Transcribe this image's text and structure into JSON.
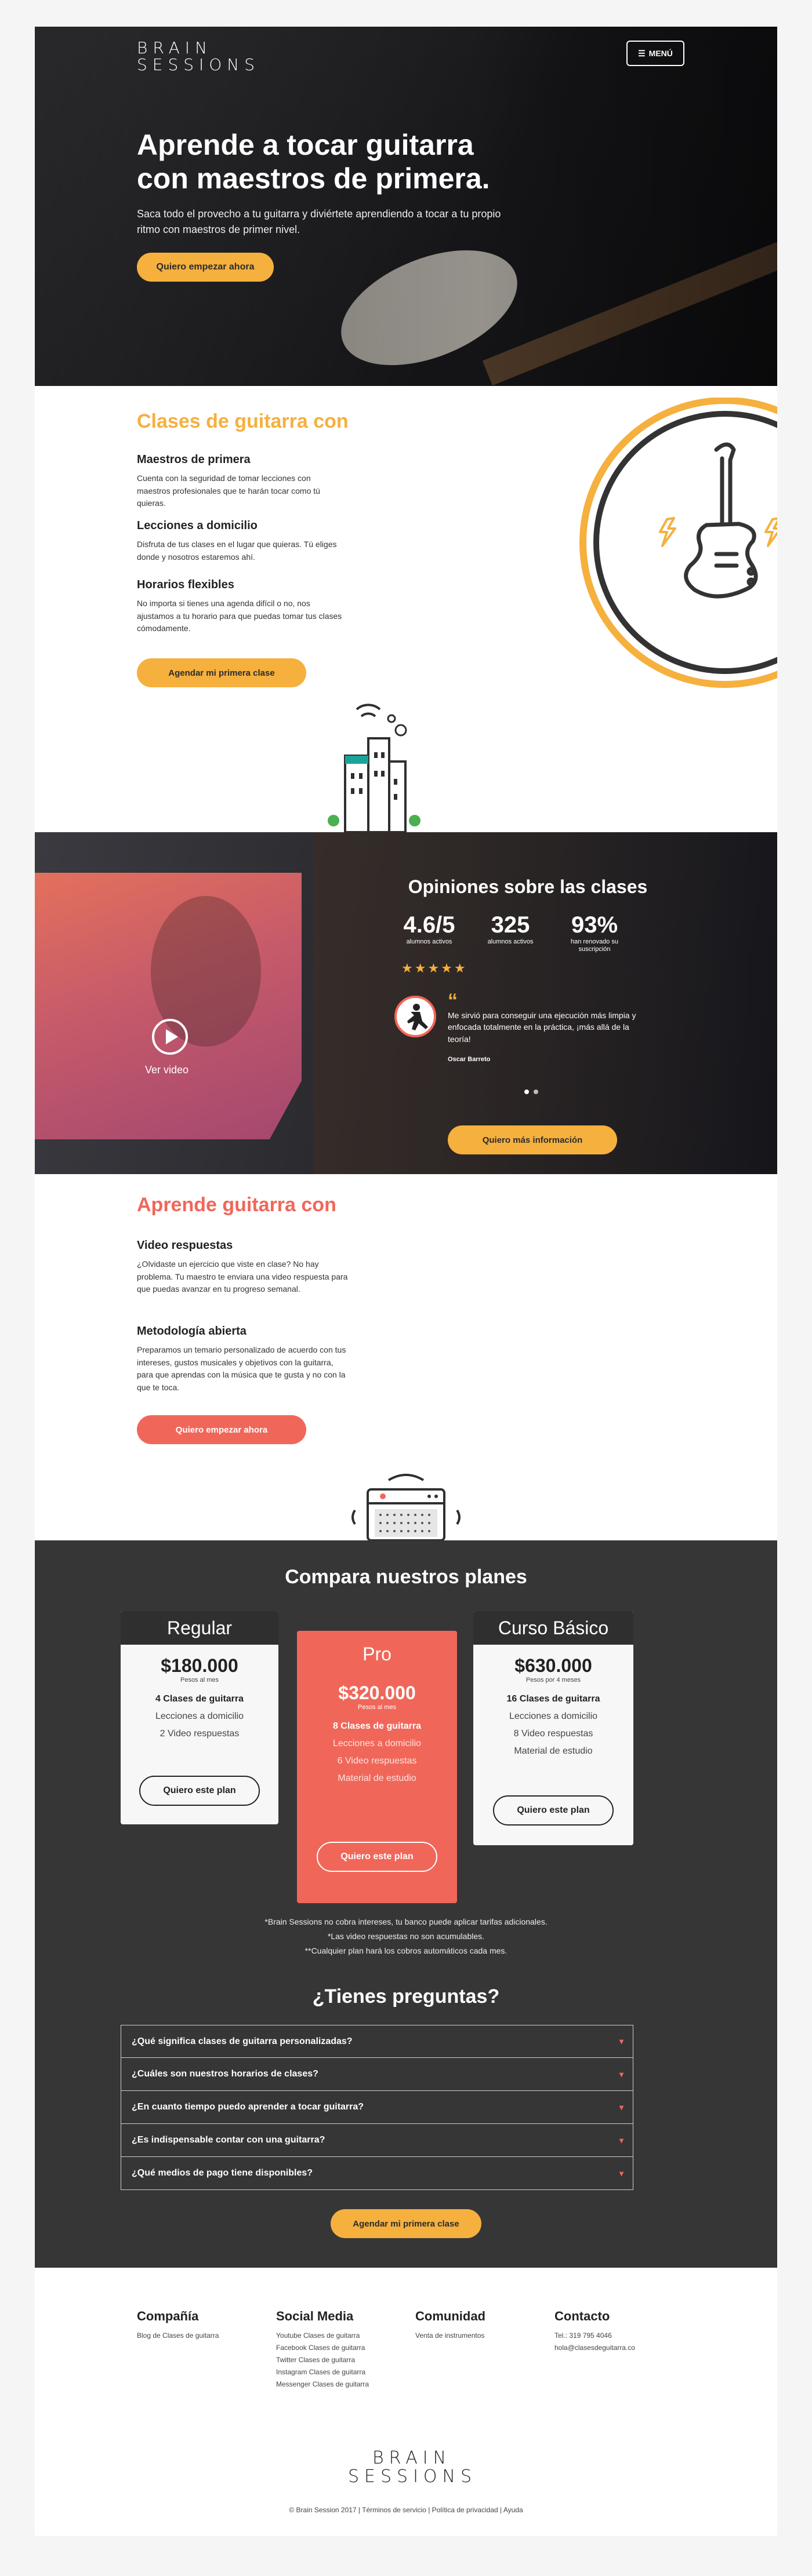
{
  "brand": {
    "logo_line1": "BRAIN",
    "logo_line2": "SESSIONS"
  },
  "nav": {
    "menu_label": "MENÚ",
    "menu_icon": "hamburger-icon"
  },
  "hero": {
    "title": "Aprende a tocar guitarra con maestros de primera.",
    "subtitle": "Saca todo el provecho a tu guitarra y diviértete aprendiendo a tocar a tu propio ritmo con maestros de primer nivel.",
    "cta": "Quiero empezar ahora"
  },
  "classes": {
    "heading": "Clases de guitarra con",
    "features": [
      {
        "title": "Maestros de primera",
        "text": "Cuenta con la seguridad de tomar lecciones con maestros profesionales que te harán tocar como tú quieras."
      },
      {
        "title": "Lecciones a domicilio",
        "text": "Disfruta de tus clases en el lugar que quieras. Tú eliges donde y nosotros estaremos ahí."
      },
      {
        "title": "Horarios flexibles",
        "text": "No importa si tienes una agenda difícil o no, nos ajustamos a tu horario para que puedas tomar tus clases cómodamente."
      }
    ],
    "cta": "Agendar mi primera clase",
    "illustration": "electric-guitar-icon"
  },
  "reviews": {
    "video_label": "Ver video",
    "heading": "Opiniones sobre las clases",
    "stats": [
      {
        "value": "4.6/5",
        "label": "alumnos activos"
      },
      {
        "value": "325",
        "label": "alumnos activos"
      },
      {
        "value": "93%",
        "label": "han renovado su suscripción"
      }
    ],
    "rating_stars": 5,
    "quote": "Me sirvió para conseguir una ejecución más limpia y enfocada totalmente en la práctica, ¡más allá de la teoría!",
    "author": "Oscar Barreto",
    "cta": "Quiero más información"
  },
  "learn": {
    "heading": "Aprende guitarra con",
    "features": [
      {
        "title": "Video respuestas",
        "text": "¿Olvidaste un ejercicio que viste en clase? No hay problema. Tu maestro te enviara una video respuesta para que puedas avanzar en tu progreso semanal."
      },
      {
        "title": "Metodología abierta",
        "text": "Preparamos un temario personalizado de acuerdo con tus intereses, gustos musicales y objetivos con la guitarra, para que aprendas con la música que te gusta y no con la que te toca."
      }
    ],
    "cta": "Quiero empezar ahora"
  },
  "plans": {
    "heading": "Compara nuestros planes",
    "items": [
      {
        "name": "Regular",
        "price": "$180.000",
        "period": "Pesos al mes",
        "features": [
          "4 Clases de guitarra",
          "Lecciones a domicilio",
          "2 Video respuestas"
        ],
        "cta": "Quiero este plan"
      },
      {
        "name": "Pro",
        "price": "$320.000",
        "period": "Pesos al mes",
        "features": [
          "8 Clases de guitarra",
          "Lecciones a domicilio",
          "6 Video respuestas",
          "Material de estudio"
        ],
        "cta": "Quiero este plan"
      },
      {
        "name": "Curso Básico",
        "price": "$630.000",
        "period": "Pesos por 4 meses",
        "features": [
          "16 Clases de guitarra",
          "Lecciones a domicilio",
          "8 Video respuestas",
          "Material de estudio"
        ],
        "cta": "Quiero este plan"
      }
    ],
    "notes": [
      "*Brain Sessions no cobra intereses, tu banco puede aplicar tarifas adicionales.",
      "*Las video respuestas no son acumulables.",
      "**Cualquier plan hará los cobros automáticos cada mes."
    ]
  },
  "faq": {
    "heading": "¿Tienes preguntas?",
    "items": [
      "¿Qué significa clases de guitarra personalizadas?",
      "¿Cuáles son nuestros horarios de clases?",
      "¿En cuanto tiempo puedo aprender a tocar guitarra?",
      "¿Es indispensable contar con una guitarra?",
      "¿Qué medios de pago tiene disponibles?"
    ],
    "cta": "Agendar mi primera clase"
  },
  "footer": {
    "columns": [
      {
        "title": "Compañía",
        "links": [
          "Blog de Clases de guitarra"
        ]
      },
      {
        "title": "Social Media",
        "links": [
          "Youtube Clases de guitarra",
          "Facebook Clases de guitarra",
          "Twitter Clases de guitarra",
          "Instagram Clases de guitarra",
          "Messenger Clases de guitarra"
        ]
      },
      {
        "title": "Comunidad",
        "links": [
          "Venta de instrumentos"
        ]
      },
      {
        "title": "Contacto",
        "links": [
          "Tel.: 319 795 4046",
          "hola@clasesdeguitarra.co"
        ]
      }
    ],
    "copyright": "© Brain Session 2017 | Términos de servicio | Política de privacidad | Ayuda"
  },
  "colors": {
    "accent_yellow": "#f5b03e",
    "accent_red": "#f0675a",
    "dark": "#363636"
  }
}
